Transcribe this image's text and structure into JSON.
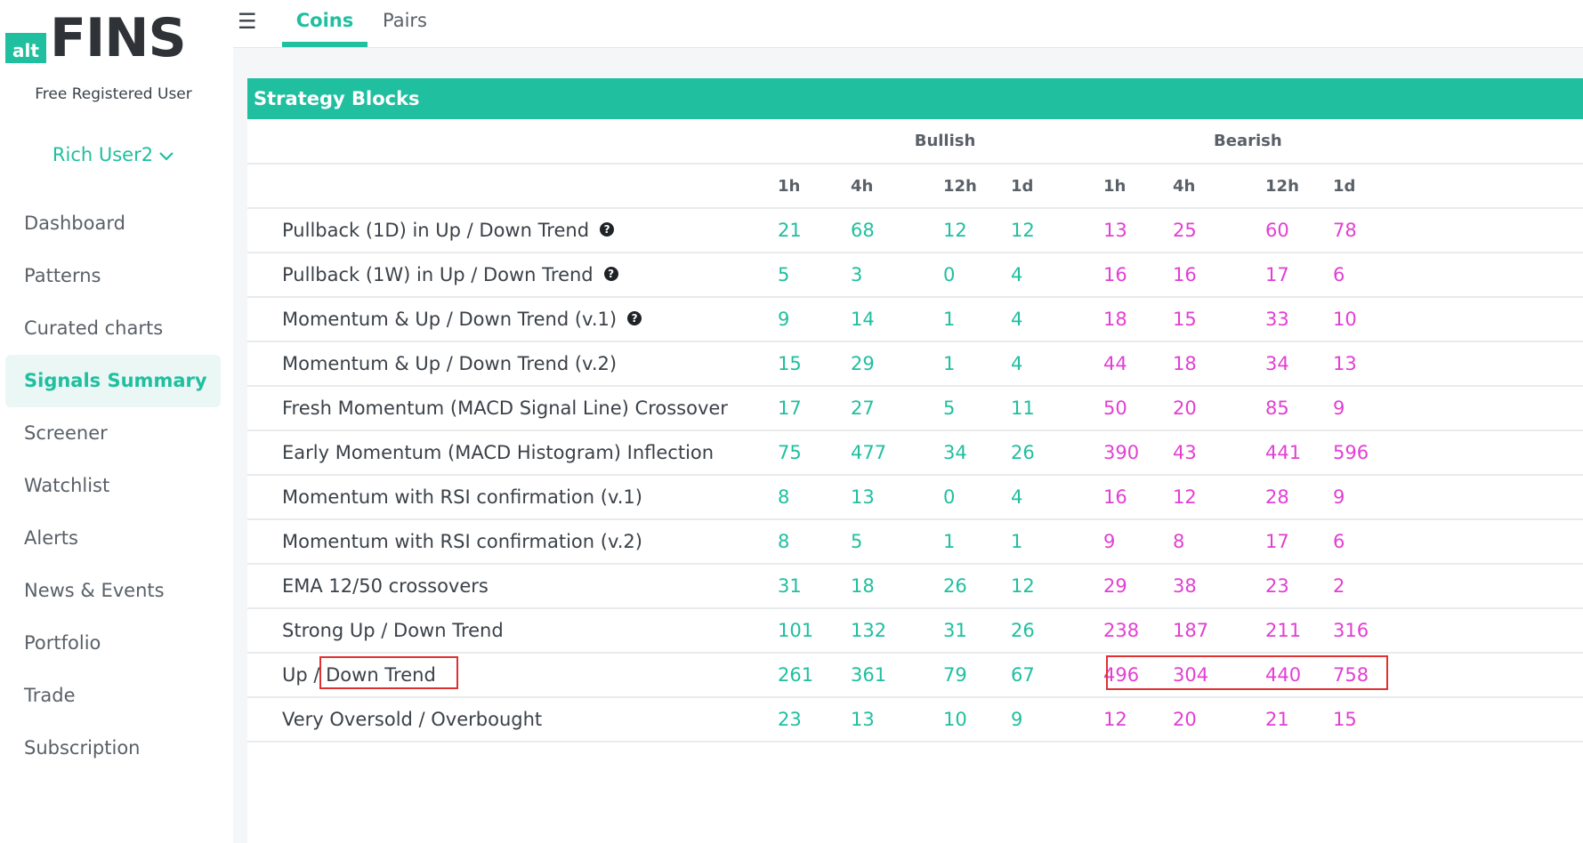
{
  "brand": {
    "logo_small": "alt",
    "logo_large": "FINS"
  },
  "user": {
    "type": "Free Registered User",
    "name": "Rich User2"
  },
  "nav": {
    "items": [
      {
        "label": "Dashboard",
        "active": false
      },
      {
        "label": "Patterns",
        "active": false
      },
      {
        "label": "Curated charts",
        "active": false
      },
      {
        "label": "Signals Summary",
        "active": true
      },
      {
        "label": "Screener",
        "active": false
      },
      {
        "label": "Watchlist",
        "active": false
      },
      {
        "label": "Alerts",
        "active": false
      },
      {
        "label": "News & Events",
        "active": false
      },
      {
        "label": "Portfolio",
        "active": false
      },
      {
        "label": "Trade",
        "active": false
      },
      {
        "label": "Subscription",
        "active": false
      }
    ]
  },
  "topbar": {
    "menu_icon": "☰",
    "tabs": [
      {
        "label": "Coins",
        "active": true
      },
      {
        "label": "Pairs",
        "active": false
      }
    ]
  },
  "panel": {
    "title": "Strategy Blocks"
  },
  "table": {
    "groups": [
      "Bullish",
      "Bearish"
    ],
    "periods": [
      "1h",
      "4h",
      "12h",
      "1d"
    ],
    "rows": [
      {
        "name": "Pullback (1D) in Up / Down Trend",
        "help": true,
        "bullish": [
          "21",
          "68",
          "12",
          "12"
        ],
        "bearish": [
          "13",
          "25",
          "60",
          "78"
        ]
      },
      {
        "name": "Pullback (1W) in Up / Down Trend",
        "help": true,
        "bullish": [
          "5",
          "3",
          "0",
          "4"
        ],
        "bearish": [
          "16",
          "16",
          "17",
          "6"
        ]
      },
      {
        "name": "Momentum & Up / Down Trend (v.1)",
        "help": true,
        "bullish": [
          "9",
          "14",
          "1",
          "4"
        ],
        "bearish": [
          "18",
          "15",
          "33",
          "10"
        ]
      },
      {
        "name": "Momentum & Up / Down Trend (v.2)",
        "help": false,
        "bullish": [
          "15",
          "29",
          "1",
          "4"
        ],
        "bearish": [
          "44",
          "18",
          "34",
          "13"
        ]
      },
      {
        "name": "Fresh Momentum (MACD Signal Line) Crossover",
        "help": false,
        "bullish": [
          "17",
          "27",
          "5",
          "11"
        ],
        "bearish": [
          "50",
          "20",
          "85",
          "9"
        ]
      },
      {
        "name": "Early Momentum (MACD Histogram) Inflection",
        "help": false,
        "bullish": [
          "75",
          "477",
          "34",
          "26"
        ],
        "bearish": [
          "390",
          "43",
          "441",
          "596"
        ]
      },
      {
        "name": "Momentum with RSI confirmation (v.1)",
        "help": false,
        "bullish": [
          "8",
          "13",
          "0",
          "4"
        ],
        "bearish": [
          "16",
          "12",
          "28",
          "9"
        ]
      },
      {
        "name": "Momentum with RSI confirmation (v.2)",
        "help": false,
        "bullish": [
          "8",
          "5",
          "1",
          "1"
        ],
        "bearish": [
          "9",
          "8",
          "17",
          "6"
        ]
      },
      {
        "name": "EMA 12/50 crossovers",
        "help": false,
        "bullish": [
          "31",
          "18",
          "26",
          "12"
        ],
        "bearish": [
          "29",
          "38",
          "23",
          "2"
        ]
      },
      {
        "name": "Strong Up / Down Trend",
        "help": false,
        "bullish": [
          "101",
          "132",
          "31",
          "26"
        ],
        "bearish": [
          "238",
          "187",
          "211",
          "316"
        ]
      },
      {
        "name": "Up / Down Trend",
        "help": false,
        "bullish": [
          "261",
          "361",
          "79",
          "67"
        ],
        "bearish": [
          "496",
          "304",
          "440",
          "758"
        ]
      },
      {
        "name": "Very Oversold / Overbought",
        "help": false,
        "bullish": [
          "23",
          "13",
          "10",
          "9"
        ],
        "bearish": [
          "12",
          "20",
          "21",
          "15"
        ]
      }
    ]
  },
  "colors": {
    "accent": "#1fbf9f",
    "bullish": "#1fbf9f",
    "bearish": "#e23fd3",
    "highlight": "#e03131"
  }
}
